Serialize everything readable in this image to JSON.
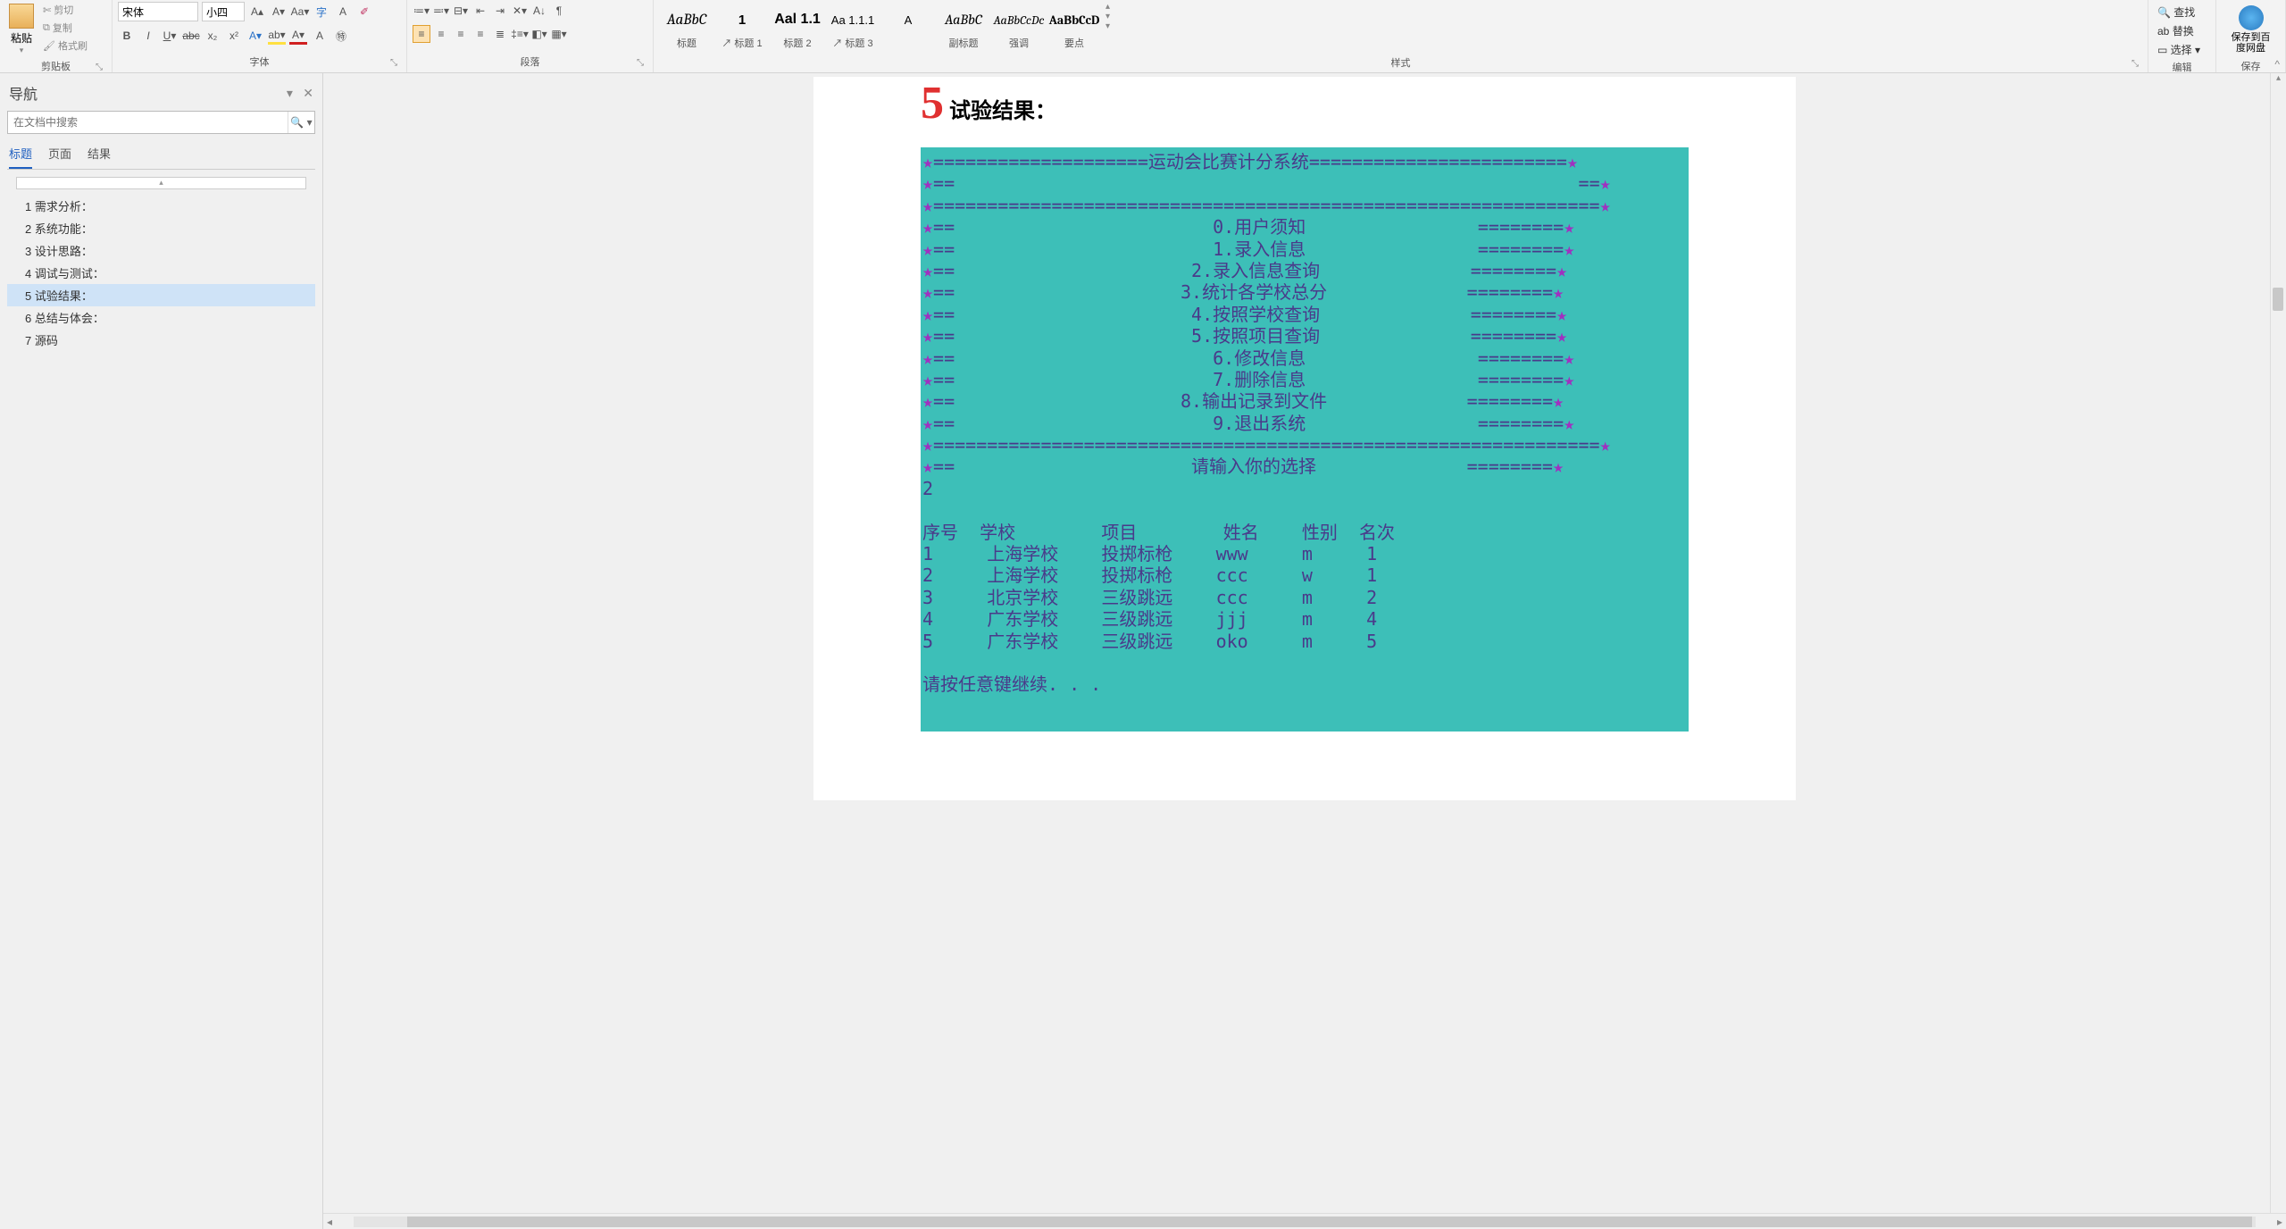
{
  "ribbon": {
    "clipboard": {
      "cut": "剪切",
      "copy": "复制",
      "paste": "粘贴",
      "format_painter": "格式刷",
      "label": "剪贴板"
    },
    "font": {
      "name": "宋体",
      "size": "小四",
      "label": "字体"
    },
    "paragraph": {
      "label": "段落"
    },
    "styles": {
      "items": [
        {
          "preview": "AaBbC",
          "label": "标题",
          "pf": "Cambria,Georgia,serif",
          "fw": "400",
          "fs": "italic",
          "sz": "17px"
        },
        {
          "preview": "1",
          "label": "↗ 标题 1",
          "pf": "Arial,sans-serif",
          "fw": "700",
          "fs": "normal",
          "sz": "15px"
        },
        {
          "preview": "Aal 1.1",
          "label": "标题 2",
          "pf": "Arial,sans-serif",
          "fw": "700",
          "fs": "normal",
          "sz": "16px"
        },
        {
          "preview": "Aa 1.1.1",
          "label": "↗ 标题 3",
          "pf": "Arial,sans-serif",
          "fw": "400",
          "fs": "normal",
          "sz": "13px"
        },
        {
          "preview": "A",
          "label": "",
          "pf": "Arial,sans-serif",
          "fw": "400",
          "fs": "normal",
          "sz": "13px"
        },
        {
          "preview": "AaBbC",
          "label": "副标题",
          "pf": "Cambria,Georgia,serif",
          "fw": "400",
          "fs": "italic",
          "sz": "16px"
        },
        {
          "preview": "AaBbCcDc",
          "label": "强调",
          "pf": "Cambria,Georgia,serif",
          "fw": "400",
          "fs": "italic",
          "sz": "14px"
        },
        {
          "preview": "AaBbCcD",
          "label": "要点",
          "pf": "Cambria,Georgia,serif",
          "fw": "700",
          "fs": "normal",
          "sz": "14px"
        }
      ],
      "label": "样式"
    },
    "editing": {
      "find": "查找",
      "replace": "替换",
      "select": "选择",
      "label": "编辑"
    },
    "save": {
      "label": "保存到百度网盘",
      "group_label": "保存"
    }
  },
  "nav": {
    "title": "导航",
    "search_placeholder": "在文档中搜索",
    "tabs": {
      "headings": "标题",
      "pages": "页面",
      "results": "结果"
    },
    "items": [
      "1 需求分析：",
      "2 系统功能：",
      "3 设计思路：",
      "4 调试与测试：",
      "5 试验结果：",
      "6 总结与体会：",
      "7 源码"
    ],
    "selected_index": 4
  },
  "document": {
    "heading_number": "5",
    "heading_text": "试验结果：",
    "console": {
      "title": "运动会比赛计分系统",
      "menu": [
        "0.用户须知",
        "1.录入信息",
        "2.录入信息查询",
        "3.统计各学校总分",
        "4.按照学校查询",
        "5.按照项目查询",
        "6.修改信息",
        "7.删除信息",
        "8.输出记录到文件",
        "9.退出系统"
      ],
      "prompt": "请输入你的选择",
      "input": "2",
      "table_header": [
        "序号",
        "学校",
        "项目",
        "姓名",
        "性别",
        "名次"
      ],
      "rows": [
        [
          "1",
          "上海学校",
          "投掷标枪",
          "www",
          "m",
          "1"
        ],
        [
          "2",
          "上海学校",
          "投掷标枪",
          "ccc",
          "w",
          "1"
        ],
        [
          "3",
          "北京学校",
          "三级跳远",
          "ccc",
          "m",
          "2"
        ],
        [
          "4",
          "广东学校",
          "三级跳远",
          "jjj",
          "m",
          "4"
        ],
        [
          "5",
          "广东学校",
          "三级跳远",
          "oko",
          "m",
          "5"
        ]
      ],
      "continue": "请按任意键继续. . ."
    }
  }
}
